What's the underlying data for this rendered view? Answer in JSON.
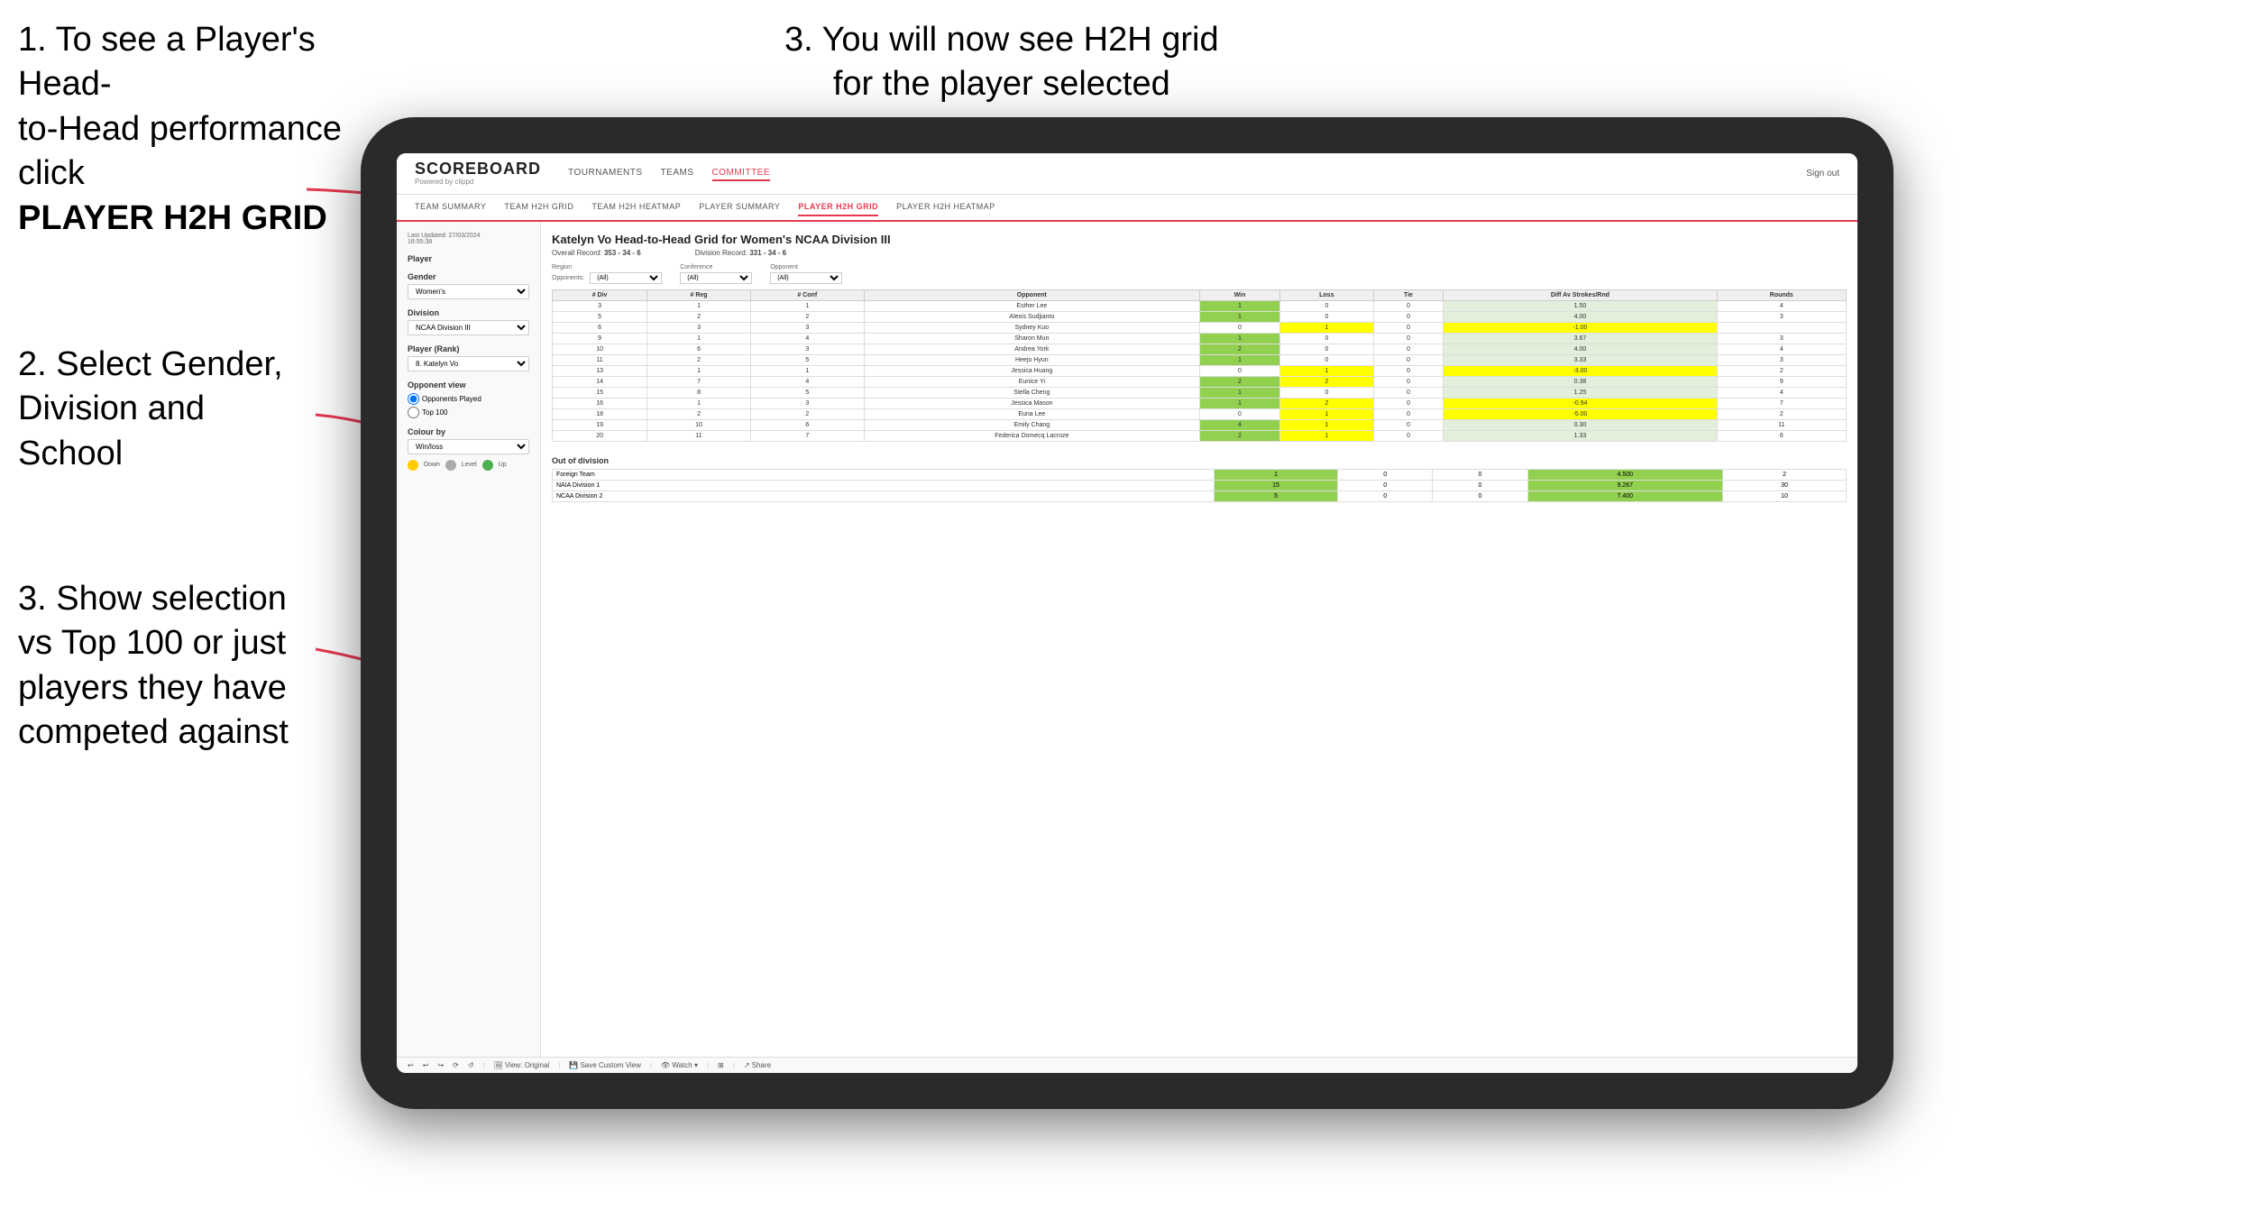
{
  "instructions": {
    "top_left_line1": "1. To see a Player's Head-",
    "top_left_line2": "to-Head performance click",
    "top_left_bold": "PLAYER H2H GRID",
    "top_right_line1": "3. You will now see H2H grid",
    "top_right_line2": "for the player selected",
    "mid_left_line1": "2. Select Gender,",
    "mid_left_line2": "Division and",
    "mid_left_line3": "School",
    "bottom_left_line1": "3. Show selection",
    "bottom_left_line2": "vs Top 100 or just",
    "bottom_left_line3": "players they have",
    "bottom_left_line4": "competed against"
  },
  "app": {
    "logo": "SCOREBOARD",
    "logo_sub": "Powered by clippd",
    "nav": [
      "TOURNAMENTS",
      "TEAMS",
      "COMMITTEE"
    ],
    "sign_out": "Sign out",
    "sub_nav": [
      "TEAM SUMMARY",
      "TEAM H2H GRID",
      "TEAM H2H HEATMAP",
      "PLAYER SUMMARY",
      "PLAYER H2H GRID",
      "PLAYER H2H HEATMAP"
    ]
  },
  "sidebar": {
    "updated": "Last Updated: 27/03/2024",
    "updated2": "16:55:38",
    "player_label": "Player",
    "gender_label": "Gender",
    "gender_value": "Women's",
    "division_label": "Division",
    "division_value": "NCAA Division III",
    "player_rank_label": "Player (Rank)",
    "player_rank_value": "8. Katelyn Vo",
    "opponent_view_label": "Opponent view",
    "radio1": "Opponents Played",
    "radio2": "Top 100",
    "colour_by_label": "Colour by",
    "colour_value": "Win/loss",
    "legend": [
      {
        "color": "#ffcc00",
        "label": "Down"
      },
      {
        "color": "#aaaaaa",
        "label": "Level"
      },
      {
        "color": "#4caf50",
        "label": "Up"
      }
    ]
  },
  "grid": {
    "title": "Katelyn Vo Head-to-Head Grid for Women's NCAA Division III",
    "overall_record_label": "Overall Record:",
    "overall_record_value": "353 - 34 - 6",
    "division_record_label": "Division Record:",
    "division_record_value": "331 - 34 - 6",
    "region_label": "Region",
    "conference_label": "Conference",
    "opponent_label": "Opponent",
    "opponents_label": "Opponents:",
    "all": "(All)",
    "col_headers": [
      "# Div",
      "# Reg",
      "# Conf",
      "Opponent",
      "Win",
      "Loss",
      "Tie",
      "Diff Av Strokes/Rnd",
      "Rounds"
    ],
    "rows": [
      {
        "div": 3,
        "reg": 1,
        "conf": 1,
        "name": "Esther Lee",
        "win": 1,
        "loss": 0,
        "tie": 0,
        "diff": "1.50",
        "rounds": 4,
        "win_class": "win-green"
      },
      {
        "div": 5,
        "reg": 2,
        "conf": 2,
        "name": "Alexis Sudjianto",
        "win": 1,
        "loss": 0,
        "tie": 0,
        "diff": "4.00",
        "rounds": 3,
        "win_class": "win-green"
      },
      {
        "div": 6,
        "reg": 3,
        "conf": 3,
        "name": "Sydney Kuo",
        "win": 0,
        "loss": 1,
        "tie": 0,
        "diff": "-1.00",
        "rounds": "",
        "win_class": "loss-yellow"
      },
      {
        "div": 9,
        "reg": 1,
        "conf": 4,
        "name": "Sharon Mun",
        "win": 1,
        "loss": 0,
        "tie": 0,
        "diff": "3.67",
        "rounds": 3,
        "win_class": "win-green"
      },
      {
        "div": 10,
        "reg": 6,
        "conf": 3,
        "name": "Andrea York",
        "win": 2,
        "loss": 0,
        "tie": 0,
        "diff": "4.00",
        "rounds": 4,
        "win_class": "win-green"
      },
      {
        "div": 11,
        "reg": 2,
        "conf": 5,
        "name": "Heejo Hyun",
        "win": 1,
        "loss": 0,
        "tie": 0,
        "diff": "3.33",
        "rounds": 3,
        "win_class": "win-green"
      },
      {
        "div": 13,
        "reg": 1,
        "conf": 1,
        "name": "Jessica Huang",
        "win": 0,
        "loss": 1,
        "tie": 0,
        "diff": "-3.00",
        "rounds": 2,
        "win_class": "loss-yellow"
      },
      {
        "div": 14,
        "reg": 7,
        "conf": 4,
        "name": "Eunice Yi",
        "win": 2,
        "loss": 2,
        "tie": 0,
        "diff": "0.38",
        "rounds": 9,
        "win_class": "neutral-white"
      },
      {
        "div": 15,
        "reg": 8,
        "conf": 5,
        "name": "Stella Cheng",
        "win": 1,
        "loss": 0,
        "tie": 0,
        "diff": "1.25",
        "rounds": 4,
        "win_class": "win-green"
      },
      {
        "div": 16,
        "reg": 1,
        "conf": 3,
        "name": "Jessica Mason",
        "win": 1,
        "loss": 2,
        "tie": 0,
        "diff": "-0.94",
        "rounds": 7,
        "win_class": "neutral-white"
      },
      {
        "div": 18,
        "reg": 2,
        "conf": 2,
        "name": "Euna Lee",
        "win": 0,
        "loss": 1,
        "tie": 0,
        "diff": "-5.00",
        "rounds": 2,
        "win_class": "loss-yellow"
      },
      {
        "div": 19,
        "reg": 10,
        "conf": 6,
        "name": "Emily Chang",
        "win": 4,
        "loss": 1,
        "tie": 0,
        "diff": "0.30",
        "rounds": 11,
        "win_class": "win-green"
      },
      {
        "div": 20,
        "reg": 11,
        "conf": 7,
        "name": "Federica Domecq Lacroze",
        "win": 2,
        "loss": 1,
        "tie": 0,
        "diff": "1.33",
        "rounds": 6,
        "win_class": "win-light"
      }
    ],
    "out_of_division_label": "Out of division",
    "out_rows": [
      {
        "name": "Foreign Team",
        "win": 1,
        "loss": 0,
        "tie": 0,
        "diff": "4.500",
        "rounds": 2,
        "win_class": "win-green"
      },
      {
        "name": "NAIA Division 1",
        "win": 15,
        "loss": 0,
        "tie": 0,
        "diff": "9.267",
        "rounds": 30,
        "win_class": "win-green"
      },
      {
        "name": "NCAA Division 2",
        "win": 5,
        "loss": 0,
        "tie": 0,
        "diff": "7.400",
        "rounds": 10,
        "win_class": "win-green"
      }
    ]
  },
  "toolbar": {
    "undo": "↩",
    "redo": "↪",
    "view_original": "View: Original",
    "save_custom": "Save Custom View",
    "watch": "Watch",
    "share": "Share"
  }
}
